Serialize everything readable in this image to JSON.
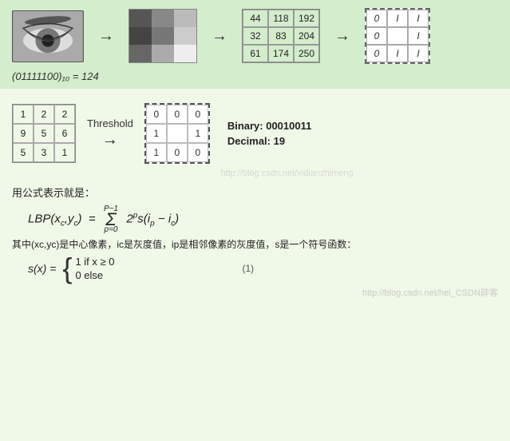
{
  "top": {
    "pixel_values": [
      [
        44,
        118,
        192
      ],
      [
        32,
        83,
        204
      ],
      [
        61,
        174,
        250
      ]
    ],
    "binary_values": [
      [
        "0",
        "I",
        "I"
      ],
      [
        "0",
        "",
        "I"
      ],
      [
        "0",
        "I",
        "I"
      ]
    ],
    "equation": "(01111100)₁₀ = 124"
  },
  "lbp": {
    "input_grid": [
      [
        1,
        2,
        2
      ],
      [
        9,
        5,
        6
      ],
      [
        5,
        3,
        1
      ]
    ],
    "threshold_label": "Threshold",
    "output_grid": [
      [
        "0",
        "0",
        "0"
      ],
      [
        "1",
        "",
        "1"
      ],
      [
        "1",
        "0",
        "0"
      ]
    ],
    "binary_result": "Binary: 00010011",
    "decimal_result": "Decimal: 19"
  },
  "formula": {
    "intro": "用公式表示就是：",
    "lbp_formula": "LBP(xc,yc) = Σ 2^p · s(ip − ic)",
    "sum_from": "p=0",
    "sum_to": "P−1",
    "desc": "其中(xc,yc)是中心像素，ic是灰度值，ip是相邻像素的灰度值，s是一个符号函数：",
    "piecewise_left": "s(x) =",
    "case1": "1   if x ≥ 0",
    "case2": "0   else",
    "eq_number": "(1)"
  },
  "watermark1": "http://blog.csdn.net/xidianzhimeng",
  "watermark2": "http://blog.csdn.net/hel_CSDN辟客"
}
